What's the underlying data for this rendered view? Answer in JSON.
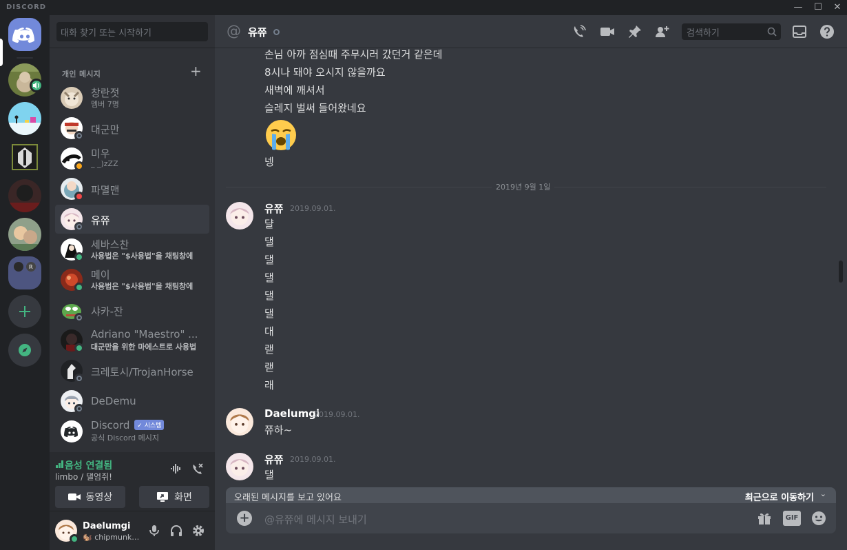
{
  "titlebar": {
    "brand": "DISCORD",
    "min": "—",
    "max": "☐",
    "close": "✕"
  },
  "sidebar": {
    "search_placeholder": "대화 찾기 또는 시작하기",
    "dm_header": "개인 메시지",
    "dm_add": "+",
    "dms": [
      {
        "name": "창란젓",
        "sub": "멤버 7명"
      },
      {
        "name": "대군만",
        "status": "offline"
      },
      {
        "name": "미우",
        "sub": "_ _)zZZ",
        "status": "idle"
      },
      {
        "name": "파멸맨",
        "status": "dnd"
      },
      {
        "name": "유쮸",
        "status": "offline",
        "selected": true
      },
      {
        "name": "세바스찬",
        "sub": "사용법은 \"$사용법\"을 채팅창에",
        "status": "online"
      },
      {
        "name": "메이",
        "sub": "사용법은 \"$사용법\"을 채팅창에",
        "status": "online"
      },
      {
        "name": "샤카-잔",
        "status": "offline"
      },
      {
        "name": "Adriano \"Maestro\" ...",
        "sub": "대군만을 위한 마에스트로 사용법",
        "status": "online"
      },
      {
        "name": "크레토시/TrojanHorse",
        "status": "offline"
      },
      {
        "name": "DeDemu",
        "status": "offline"
      },
      {
        "name": "Discord",
        "badge": "✓ 시스템",
        "sub": "공식 Discord 메시지"
      }
    ]
  },
  "voice": {
    "title": "음성 연결됨",
    "channel": "limbo / 댈엄쥐!",
    "video_label": "동영상",
    "screen_label": "화면"
  },
  "user": {
    "name": "Daelumgi",
    "tag": "🐿️ chipmunk is cute"
  },
  "header": {
    "at": "@",
    "channel": "유쮸",
    "search_placeholder": "검색하기"
  },
  "messages": {
    "early_lines": [
      "손님 아까 점심때 주무시러 갔던거 같은데",
      "8시나 돼야 오시지 않을까요",
      "새벽에 깨셔서",
      "슬레지 벌써 들어왔네요"
    ],
    "after_emoji": "넹",
    "divider": "2019년 9월 1일",
    "group1": {
      "author": "유쮸",
      "time": "2019.09.01.",
      "lines": [
        "댤",
        "댈",
        "댈",
        "댈",
        "댈",
        "댈",
        "대",
        "랟",
        "랟",
        "래"
      ]
    },
    "group2": {
      "author": "Daelumgi",
      "time": "2019.09.01.",
      "lines": [
        "쮸하~"
      ]
    },
    "group3": {
      "author": "유쮸",
      "time": "2019.09.01.",
      "lines": [
        "댈"
      ]
    }
  },
  "jump": {
    "left": "오래된 메시지를 보고 있어요",
    "right": "최근으로 이동하기",
    "chev": "⌄"
  },
  "composer": {
    "placeholder": "@유쮸에 메시지 보내기",
    "plus": "+",
    "gif": "GIF"
  },
  "colors": {
    "blurple": "#7289da",
    "green": "#43b581",
    "idle": "#faa61a",
    "dnd": "#f04747"
  }
}
